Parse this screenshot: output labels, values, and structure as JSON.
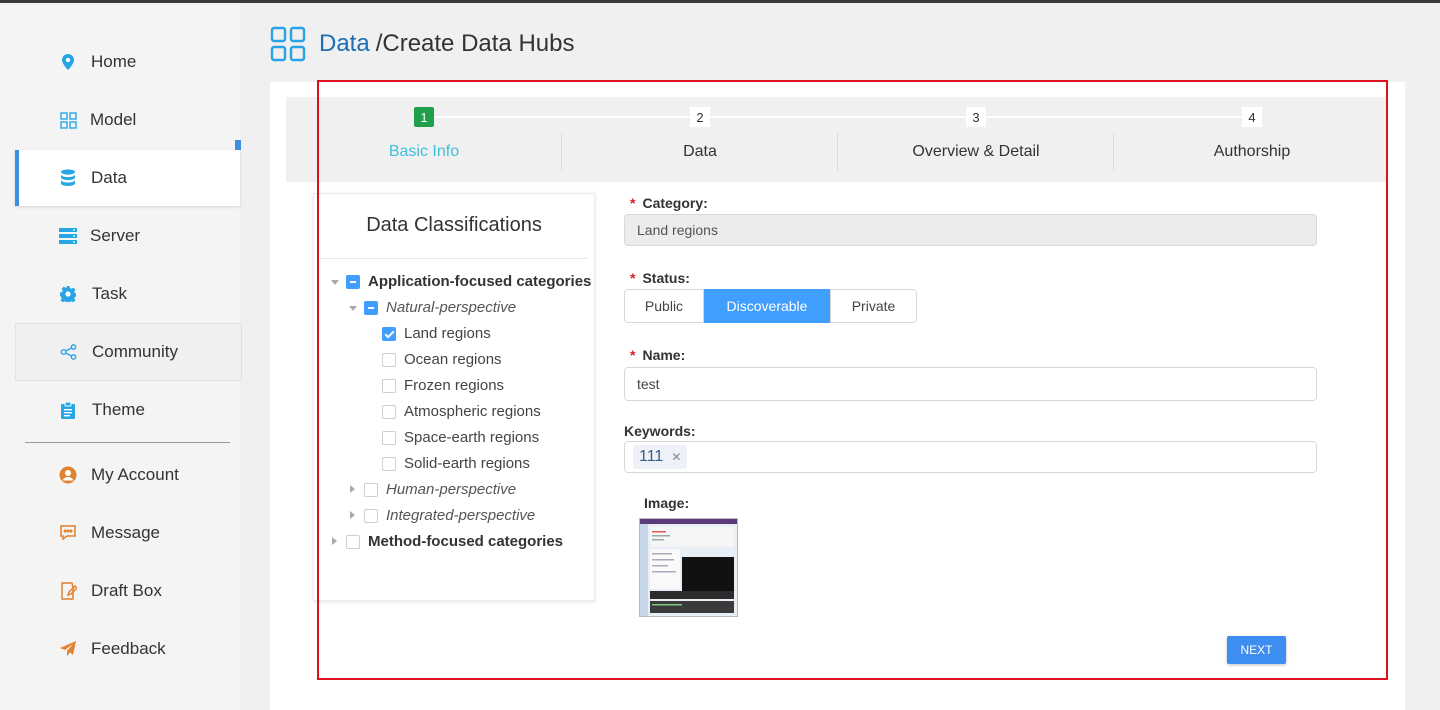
{
  "header": {
    "crumb_link": "Data",
    "crumb_rest": "/Create Data Hubs"
  },
  "sidebar": {
    "items": [
      {
        "label": "Home",
        "icon": "location-pin-icon"
      },
      {
        "label": "Model",
        "icon": "grid-icon"
      },
      {
        "label": "Data",
        "icon": "database-icon",
        "active": true
      },
      {
        "label": "Server",
        "icon": "server-icon"
      },
      {
        "label": "Task",
        "icon": "gear-icon"
      },
      {
        "label": "Community",
        "icon": "share-icon"
      },
      {
        "label": "Theme",
        "icon": "clipboard-icon"
      },
      {
        "label": "My Account",
        "icon": "user-circle-icon"
      },
      {
        "label": "Message",
        "icon": "chat-icon"
      },
      {
        "label": "Draft Box",
        "icon": "edit-icon"
      },
      {
        "label": "Feedback",
        "icon": "paper-plane-icon"
      }
    ]
  },
  "steps": [
    {
      "num": "1",
      "title": "Basic Info",
      "active": true
    },
    {
      "num": "2",
      "title": "Data"
    },
    {
      "num": "3",
      "title": "Overview & Detail"
    },
    {
      "num": "4",
      "title": "Authorship"
    }
  ],
  "classifications": {
    "title": "Data Classifications",
    "tree": [
      {
        "label": "Application-focused categories"
      },
      {
        "label": "Natural-perspective"
      },
      {
        "label": "Land regions"
      },
      {
        "label": "Ocean regions"
      },
      {
        "label": "Frozen regions"
      },
      {
        "label": "Atmospheric regions"
      },
      {
        "label": "Space-earth regions"
      },
      {
        "label": "Solid-earth regions"
      },
      {
        "label": "Human-perspective"
      },
      {
        "label": "Integrated-perspective"
      },
      {
        "label": "Method-focused categories"
      }
    ]
  },
  "form": {
    "category_label": "Category:",
    "category_value": "Land regions",
    "status_label": "Status:",
    "status_options": [
      "Public",
      "Discoverable",
      "Private"
    ],
    "status_selected": "Discoverable",
    "name_label": "Name:",
    "name_value": "test",
    "keywords_label": "Keywords:",
    "keywords": [
      "111"
    ],
    "image_label": "Image:",
    "next_label": "NEXT"
  },
  "colors": {
    "accent": "#409eff",
    "step_active": "#21a04b",
    "step_title_active": "#3ec1d6",
    "highlight_box": "#d9141c"
  }
}
